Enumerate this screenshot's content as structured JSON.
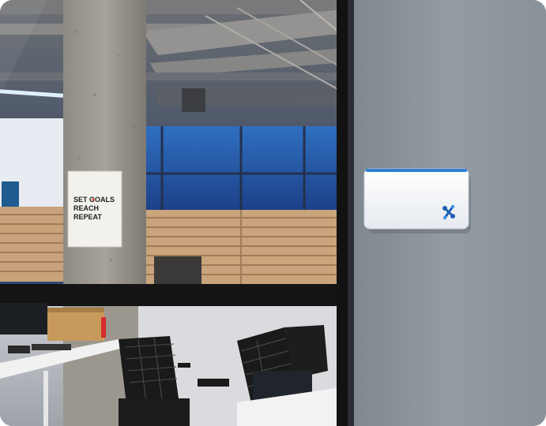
{
  "photo": {
    "scene": "office-glass-wall-with-wall-mounted-device",
    "poster": {
      "lines": [
        "SET GOALS",
        "REACH",
        "REPEAT"
      ]
    },
    "device": {
      "logo": "node-link-logo",
      "accent_color": "#2f7fd6"
    },
    "colors": {
      "wall": "#8c949c",
      "mullion": "#121212",
      "ceiling_light": "#cde6ff"
    }
  }
}
